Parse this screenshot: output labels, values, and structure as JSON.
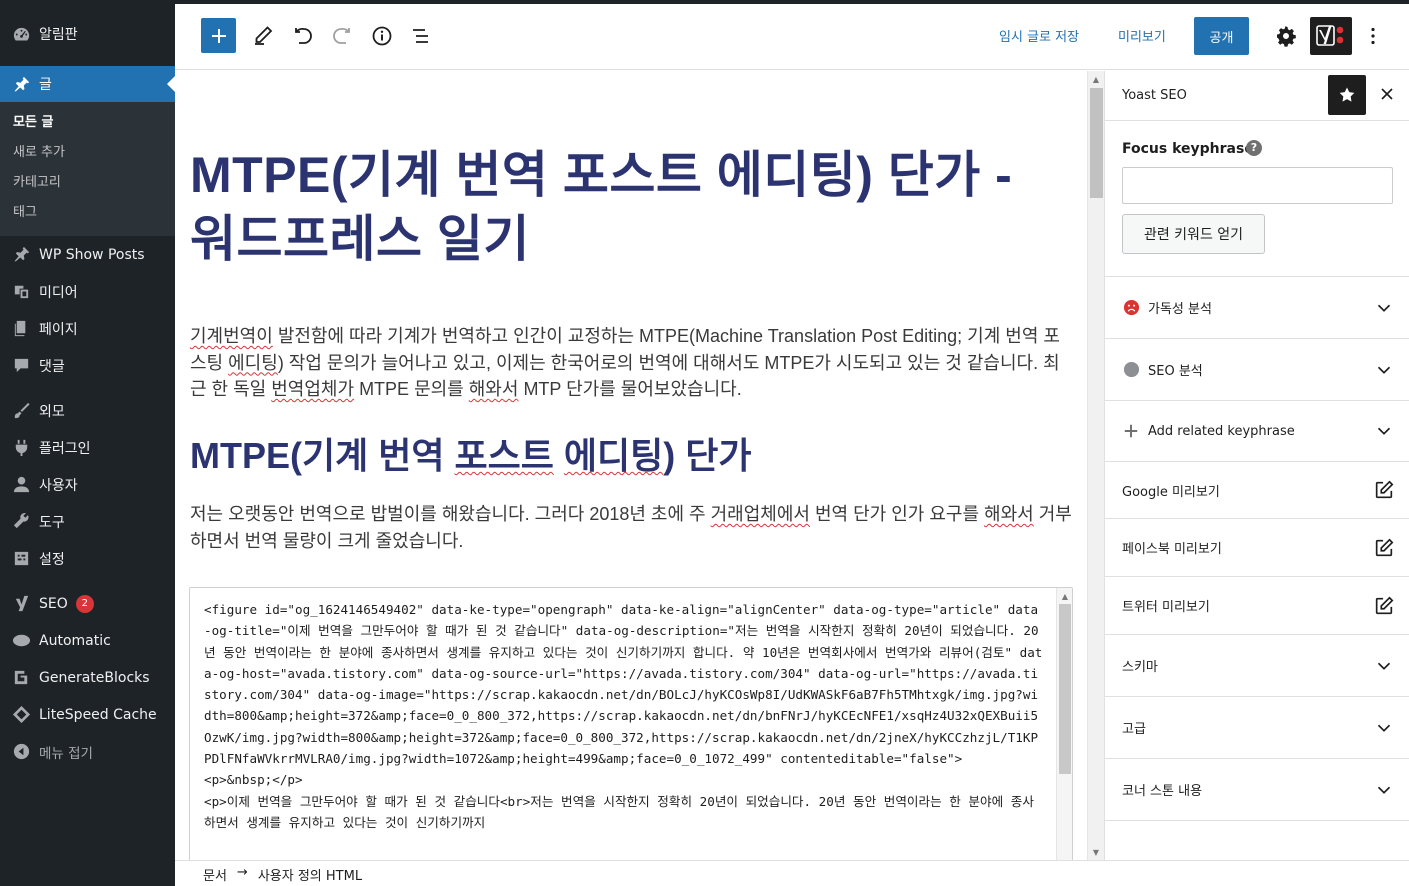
{
  "admin_menu": {
    "items": [
      {
        "label": "알림판",
        "icon": "dashboard-icon"
      },
      {
        "label": "글",
        "icon": "pin-icon",
        "current": true
      },
      {
        "label": "WP Show Posts",
        "icon": "pin-icon"
      },
      {
        "label": "미디어",
        "icon": "media-icon"
      },
      {
        "label": "페이지",
        "icon": "page-icon"
      },
      {
        "label": "댓글",
        "icon": "comment-icon"
      },
      {
        "label": "외모",
        "icon": "brush-icon"
      },
      {
        "label": "플러그인",
        "icon": "plugin-icon"
      },
      {
        "label": "사용자",
        "icon": "user-icon"
      },
      {
        "label": "도구",
        "icon": "wrench-icon"
      },
      {
        "label": "설정",
        "icon": "settings-icon"
      },
      {
        "label": "SEO",
        "icon": "yoast-icon",
        "badge": "2"
      },
      {
        "label": "Automatic",
        "icon": "automatic-icon"
      },
      {
        "label": "GenerateBlocks",
        "icon": "generateblocks-icon"
      },
      {
        "label": "LiteSpeed Cache",
        "icon": "litespeed-icon"
      },
      {
        "label": "메뉴 접기",
        "icon": "collapse-icon"
      }
    ],
    "submenu": [
      "모든 글",
      "새로 추가",
      "카테고리",
      "태그"
    ]
  },
  "header": {
    "save_draft": "임시 글로 저장",
    "preview": "미리보기",
    "publish": "공개"
  },
  "post": {
    "title": "MTPE(기계 번역 포스트 에디팅) 단가 - 워드프레스 일기",
    "p1": {
      "t1": "기계번역이",
      "t2": " 발전함에 따라 기계가 번역하고 인간이 교정하는 MTPE(Machine Translation Post Editing; 기계 번역 포스팅 ",
      "t3": "에디팅",
      "t4": ") 작업 문의가 늘어나고 있고, 이제는 한국어로의 번역에 대해서도 MTPE가 시도되고 있는 것 같습니다. 최근 한 독일 ",
      "t5": "번역업체가",
      "t6": " MTPE 문의를 ",
      "t7": "해와서",
      "t8": " MTP 단가를 물어보았습니다."
    },
    "heading": {
      "t1": "MTPE(기계 번역 ",
      "t2": "포스트",
      "t3": " ",
      "t4": "에디팅",
      "t5": ") 단가"
    },
    "p2": {
      "t1": "저는 오랫동안 번역으로 밥벌이를 해왔습니다. 그러다 2018년 초에 주 ",
      "t2": "거래업체에서",
      "t3": " 번역 단가 인가 요구를 ",
      "t4": "해와서",
      "t5": " 거부하면서 번역 물량이 크게 줄었습니다."
    },
    "html_code": "<figure id=\"og_1624146549402\" data-ke-type=\"opengraph\" data-ke-align=\"alignCenter\" data-og-type=\"article\" data-og-title=\"이제 번역을 그만두어야 할 때가 된 것 같습니다\" data-og-description=\"저는 번역을 시작한지 정확히 20년이 되었습니다. 20년 동안 번역이라는 한 분야에 종사하면서 생계를 유지하고 있다는 것이 신기하기까지 합니다. 약 10년은 번역회사에서 번역가와 리뷰어(검토\" data-og-host=\"avada.tistory.com\" data-og-source-url=\"https://avada.tistory.com/304\" data-og-url=\"https://avada.tistory.com/304\" data-og-image=\"https://scrap.kakaocdn.net/dn/BOLcJ/hyKCOsWp8I/UdKWASkF6aB7Fh5TMhtxgk/img.jpg?width=800&amp;height=372&amp;face=0_0_800_372,https://scrap.kakaocdn.net/dn/bnFNrJ/hyKCEcNFE1/xsqHz4U32xQEXBuii5OzwK/img.jpg?width=800&amp;height=372&amp;face=0_0_800_372,https://scrap.kakaocdn.net/dn/2jneX/hyKCCzhzjL/T1KPPDlFNfaWVkrrMVLRA0/img.jpg?width=1072&amp;height=499&amp;face=0_0_1072_499\" contenteditable=\"false\">\n<p>&nbsp;</p>\n<p>이제 번역을 그만두어야 할 때가 된 것 같습니다<br>저는 번역을 시작한지 정확히 20년이 되었습니다. 20년 동안 번역이라는 한 분야에 종사하면서 생계를 유지하고 있다는 것이 신기하기까지"
  },
  "footer": {
    "crumb_root": "문서",
    "crumb_arrow": "→",
    "crumb_current": "사용자 정의 HTML"
  },
  "yoast": {
    "title": "Yoast SEO",
    "focus_label": "Focus keyphrase",
    "focus_value": "",
    "related_button": "관련 키워드 얻기",
    "rows": [
      {
        "label": "가독성 분석",
        "icon": "sad-face-icon",
        "end": "chevron-down-icon"
      },
      {
        "label": "SEO 분석",
        "icon": "grey-dot-icon",
        "end": "chevron-down-icon"
      },
      {
        "label": "Add related keyphrase",
        "icon": "plus-icon",
        "end": "chevron-down-icon"
      },
      {
        "label": "Google 미리보기",
        "end": "edit-icon"
      },
      {
        "label": "페이스북 미리보기",
        "end": "edit-icon"
      },
      {
        "label": "트위터 미리보기",
        "end": "edit-icon"
      },
      {
        "label": "스키마",
        "end": "chevron-down-icon"
      },
      {
        "label": "고급",
        "end": "chevron-down-icon"
      },
      {
        "label": "코너 스톤 내용",
        "end": "chevron-down-icon"
      }
    ]
  },
  "colors": {
    "admin_bg": "#1d2327",
    "accent": "#2271b1",
    "title": "#2b3370",
    "error": "#d63638"
  }
}
